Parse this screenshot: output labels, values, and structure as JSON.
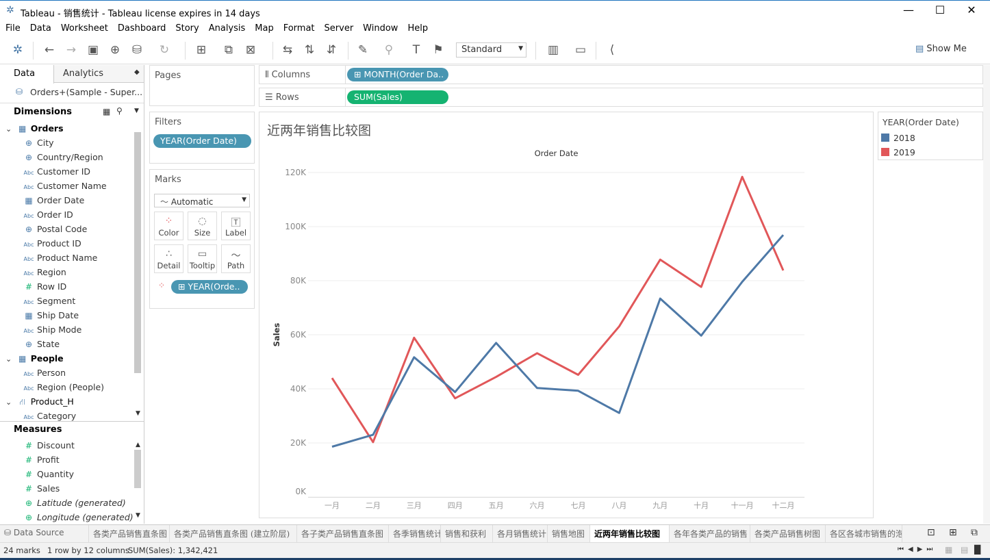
{
  "window": {
    "title": "Tableau - 销售统计 - Tableau license expires in 14 days",
    "minimize": "—",
    "maximize": "☐",
    "close": "✕"
  },
  "menu": [
    "File",
    "Data",
    "Worksheet",
    "Dashboard",
    "Story",
    "Analysis",
    "Map",
    "Format",
    "Server",
    "Window",
    "Help"
  ],
  "toolbar": {
    "fit": "Standard",
    "show_me": "Show Me"
  },
  "data_pane": {
    "tab_data": "Data",
    "tab_analytics": "Analytics",
    "datasource": "Orders+(Sample - Super...",
    "dimensions_label": "Dimensions",
    "measures_label": "Measures",
    "dimensions": [
      {
        "label": "Orders",
        "type": "table",
        "group": true
      },
      {
        "label": "City",
        "type": "geo"
      },
      {
        "label": "Country/Region",
        "type": "geo"
      },
      {
        "label": "Customer ID",
        "type": "abc"
      },
      {
        "label": "Customer Name",
        "type": "abc"
      },
      {
        "label": "Order Date",
        "type": "date"
      },
      {
        "label": "Order ID",
        "type": "abc"
      },
      {
        "label": "Postal Code",
        "type": "geo"
      },
      {
        "label": "Product ID",
        "type": "abc"
      },
      {
        "label": "Product Name",
        "type": "abc"
      },
      {
        "label": "Region",
        "type": "abc"
      },
      {
        "label": "Row ID",
        "type": "num"
      },
      {
        "label": "Segment",
        "type": "abc"
      },
      {
        "label": "Ship Date",
        "type": "date"
      },
      {
        "label": "Ship Mode",
        "type": "abc"
      },
      {
        "label": "State",
        "type": "geo"
      },
      {
        "label": "People",
        "type": "table",
        "group": true
      },
      {
        "label": "Person",
        "type": "abc"
      },
      {
        "label": "Region (People)",
        "type": "abc"
      },
      {
        "label": "Product_H",
        "type": "hier",
        "group": false
      },
      {
        "label": "Category",
        "type": "abc"
      }
    ],
    "measures": [
      {
        "label": "Discount",
        "type": "num"
      },
      {
        "label": "Profit",
        "type": "num"
      },
      {
        "label": "Quantity",
        "type": "num"
      },
      {
        "label": "Sales",
        "type": "num"
      },
      {
        "label": "Latitude (generated)",
        "type": "geo"
      },
      {
        "label": "Longitude (generated)",
        "type": "geo"
      }
    ]
  },
  "pages_label": "Pages",
  "filters": {
    "label": "Filters",
    "items": [
      "YEAR(Order Date)"
    ]
  },
  "marks": {
    "label": "Marks",
    "type": "Automatic",
    "buttons": [
      "Color",
      "Size",
      "Label",
      "Detail",
      "Tooltip",
      "Path"
    ],
    "pill": "YEAR(Orde.."
  },
  "columns": {
    "label": "Columns",
    "pill": "MONTH(Order Da.."
  },
  "rows": {
    "label": "Rows",
    "pill": "SUM(Sales)"
  },
  "legend": {
    "title": "YEAR(Order Date)",
    "items": [
      {
        "label": "2018",
        "color": "#4e79a7"
      },
      {
        "label": "2019",
        "color": "#e15759"
      }
    ]
  },
  "chart_data": {
    "type": "line",
    "title": "近两年销售比较图",
    "xlabel": "Order Date",
    "ylabel": "Sales",
    "categories": [
      "一月",
      "二月",
      "三月",
      "四月",
      "五月",
      "六月",
      "七月",
      "八月",
      "九月",
      "十月",
      "十一月",
      "十二月"
    ],
    "yticks": [
      "0K",
      "20K",
      "40K",
      "60K",
      "80K",
      "100K",
      "120K"
    ],
    "ylim": [
      0,
      120000
    ],
    "grid": true,
    "legend": "right",
    "series": [
      {
        "name": "2018",
        "color": "#4e79a7",
        "values": [
          18600,
          23000,
          51700,
          38800,
          57000,
          40300,
          39300,
          31100,
          73400,
          59700,
          79600,
          96900
        ]
      },
      {
        "name": "2019",
        "color": "#e15759",
        "values": [
          44000,
          20300,
          58900,
          36500,
          44400,
          53200,
          45200,
          63100,
          87800,
          77700,
          118400,
          83800
        ]
      }
    ]
  },
  "sheet_tabs": {
    "data_source": "Data Source",
    "tabs": [
      "各类产品销售直条图",
      "各类产品销售直条图 (建立阶层)",
      "各子类产品销售直条图",
      "各季销售统计",
      "销售和获利",
      "各月销售统计",
      "销售地图",
      "近两年销售比较图",
      "各年各类产品的销售",
      "各类产品销售树图",
      "各区各城市销售的泡"
    ],
    "active": 7
  },
  "status": {
    "marks": "24 marks",
    "dims": "1 row by 12 columns",
    "sum": "SUM(Sales): 1,342,421"
  }
}
